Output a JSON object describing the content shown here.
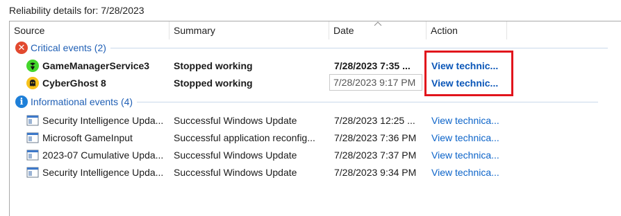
{
  "heading": "Reliability details for: 7/28/2023",
  "columns": {
    "source": "Source",
    "summary": "Summary",
    "date": "Date",
    "action": "Action"
  },
  "groups": {
    "critical": {
      "label": "Critical events (2)",
      "icon": "error-icon",
      "color": "#e2492f"
    },
    "info": {
      "label": "Informational events (4)",
      "icon": "info-icon",
      "color": "#1e7fd8"
    }
  },
  "critical_rows": [
    {
      "source": "GameManagerService3",
      "summary": "Stopped working",
      "date": "7/28/2023 7:35 ...",
      "action": "View technic...",
      "icon": "razer-logo-icon"
    },
    {
      "source": "CyberGhost 8",
      "summary": "Stopped working",
      "date": "7/28/2023 9:17 PM",
      "action": "View technic...",
      "icon": "ghost-icon"
    }
  ],
  "info_rows": [
    {
      "source": "Security Intelligence Upda...",
      "summary": "Successful Windows Update",
      "date": "7/28/2023 12:25 ...",
      "action": "View technica...",
      "icon": "application-window-icon"
    },
    {
      "source": "Microsoft GameInput",
      "summary": "Successful application reconfig...",
      "date": "7/28/2023 7:36 PM",
      "action": "View technica...",
      "icon": "application-window-icon"
    },
    {
      "source": "2023-07 Cumulative Upda...",
      "summary": "Successful Windows Update",
      "date": "7/28/2023 7:37 PM",
      "action": "View technica...",
      "icon": "application-window-icon"
    },
    {
      "source": "Security Intelligence Upda...",
      "summary": "Successful Windows Update",
      "date": "7/28/2023 9:34 PM",
      "action": "View technica...",
      "icon": "application-window-icon"
    }
  ],
  "colors": {
    "link": "#0b63c9",
    "highlight_border": "#e1141c",
    "group_text": "#1f5fb5"
  }
}
